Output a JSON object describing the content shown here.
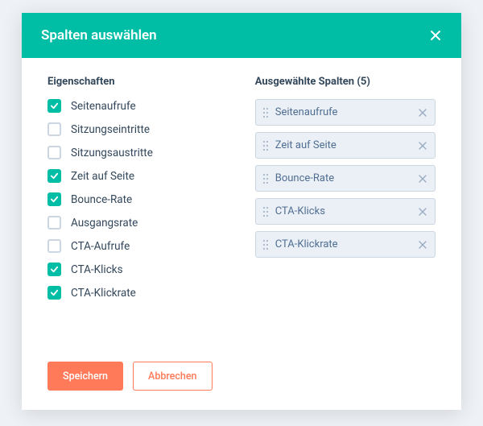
{
  "header": {
    "title": "Spalten auswählen"
  },
  "properties": {
    "title": "Eigenschaften",
    "items": [
      {
        "label": "Seitenaufrufe",
        "checked": true
      },
      {
        "label": "Sitzungseintritte",
        "checked": false
      },
      {
        "label": "Sitzungsaustritte",
        "checked": false
      },
      {
        "label": "Zeit auf Seite",
        "checked": true
      },
      {
        "label": "Bounce-Rate",
        "checked": true
      },
      {
        "label": "Ausgangsrate",
        "checked": false
      },
      {
        "label": "CTA-Aufrufe",
        "checked": false
      },
      {
        "label": "CTA-Klicks",
        "checked": true
      },
      {
        "label": "CTA-Klickrate",
        "checked": true
      }
    ]
  },
  "selected": {
    "title": "Ausgewählte Spalten (5)",
    "items": [
      {
        "label": "Seitenaufrufe"
      },
      {
        "label": "Zeit auf Seite"
      },
      {
        "label": "Bounce-Rate"
      },
      {
        "label": "CTA-Klicks"
      },
      {
        "label": "CTA-Klickrate"
      }
    ]
  },
  "footer": {
    "save": "Speichern",
    "cancel": "Abbrechen"
  }
}
